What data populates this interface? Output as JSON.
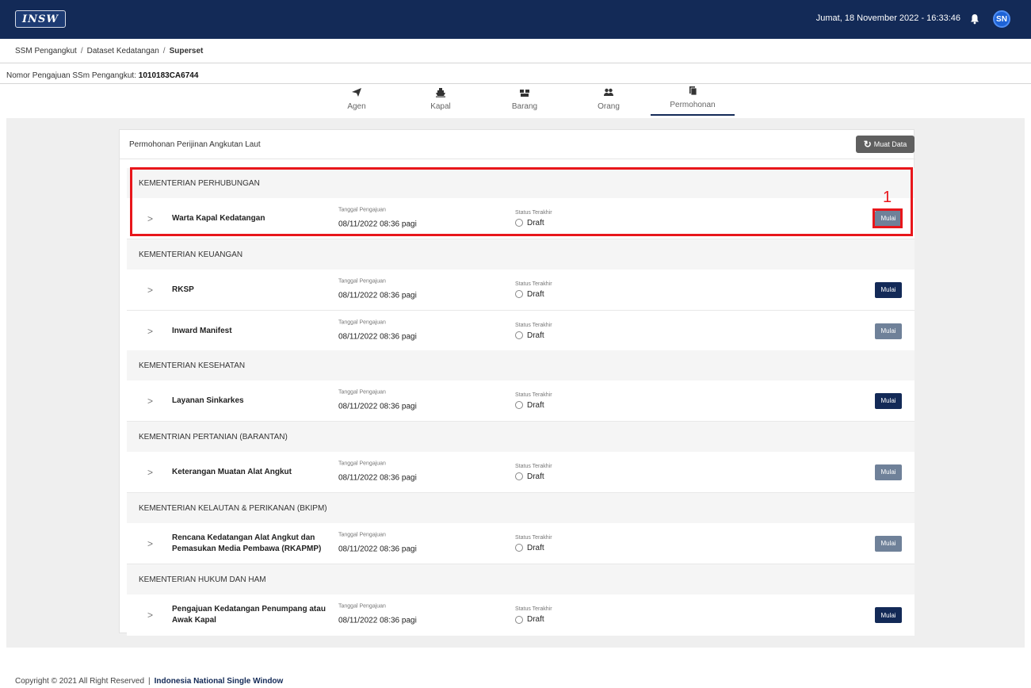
{
  "topbar": {
    "logo_text": "INSW",
    "datetime": "Jumat, 18 November 2022 - 16:33:46",
    "avatar": "SN",
    "bg_color": "#132a57"
  },
  "breadcrumb": [
    "SSM Pengangkut",
    "Dataset Kedatangan",
    "Superset"
  ],
  "submission": {
    "label": "Nomor Pengajuan SSm Pengangkut:",
    "number": "1010183CA6744"
  },
  "tabs": [
    {
      "label": "Agen",
      "icon": "paper-plane-icon"
    },
    {
      "label": "Kapal",
      "icon": "ship-icon"
    },
    {
      "label": "Barang",
      "icon": "boxes-icon"
    },
    {
      "label": "Orang",
      "icon": "users-icon"
    },
    {
      "label": "Permohonan",
      "icon": "documents-icon",
      "active": true
    }
  ],
  "card": {
    "title": "Permohonan Perijinan Angkutan Laut",
    "reload_label": "Muat Data"
  },
  "labels": {
    "date": "Tanggal Pengajuan",
    "status": "Status Terakhir",
    "button": "Mulai"
  },
  "ministries": [
    {
      "name": "KEMENTERIAN PERHUBUNGAN",
      "items": [
        {
          "title": "Warta Kapal Kedatangan",
          "date": "08/11/2022 08:36 pagi",
          "status": "Draft",
          "button_state": "disabled"
        }
      ]
    },
    {
      "name": "KEMENTERIAN KEUANGAN",
      "items": [
        {
          "title": "RKSP",
          "date": "08/11/2022 08:36 pagi",
          "status": "Draft",
          "button_state": "active"
        },
        {
          "title": "Inward Manifest",
          "date": "08/11/2022 08:36 pagi",
          "status": "Draft",
          "button_state": "disabled"
        }
      ]
    },
    {
      "name": "KEMENTERIAN KESEHATAN",
      "items": [
        {
          "title": "Layanan Sinkarkes",
          "date": "08/11/2022 08:36 pagi",
          "status": "Draft",
          "button_state": "active"
        }
      ]
    },
    {
      "name": "KEMENTRIAN PERTANIAN (BARANTAN)",
      "items": [
        {
          "title": "Keterangan Muatan Alat Angkut",
          "date": "08/11/2022 08:36 pagi",
          "status": "Draft",
          "button_state": "disabled"
        }
      ]
    },
    {
      "name": "KEMENTERIAN KELAUTAN & PERIKANAN (BKIPM)",
      "items": [
        {
          "title": "Rencana Kedatangan Alat Angkut dan Pemasukan Media Pembawa (RKAPMP)",
          "date": "08/11/2022 08:36 pagi",
          "status": "Draft",
          "button_state": "disabled"
        }
      ]
    },
    {
      "name": "KEMENTERIAN HUKUM DAN HAM",
      "items": [
        {
          "title": "Pengajuan Kedatangan Penumpang atau Awak Kapal",
          "date": "08/11/2022 08:36 pagi",
          "status": "Draft",
          "button_state": "active"
        }
      ]
    }
  ],
  "annotation": {
    "number": "1",
    "color": "#e8161b"
  },
  "footer": {
    "copyright": "Copyright © 2021 All Right Reserved",
    "brand": "Indonesia National Single Window"
  }
}
